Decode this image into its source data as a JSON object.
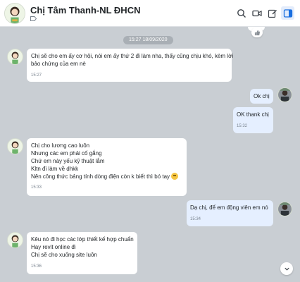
{
  "header": {
    "contact_name": "Chị Tâm Thanh-NL ĐHCN",
    "icons": [
      "search-icon",
      "video-call-icon",
      "edit-icon",
      "sidebar-toggle-icon"
    ]
  },
  "date_divider": "15:27 18/09/2020",
  "messages": [
    {
      "direction": "in",
      "lines": [
        "Chị sẽ cho em ấy cơ hội, nói em ấy thứ 2 đi làm nha, thấy cũng chịu khó, kèm lời",
        "bảo chứng của em nè"
      ],
      "time": "15:27"
    },
    {
      "direction": "out",
      "lines": [
        "Ok chị"
      ]
    },
    {
      "direction": "out",
      "lines": [
        "OK thank chị"
      ],
      "time": "15:32"
    },
    {
      "direction": "in",
      "lines": [
        "Chị cho lương cao luôn",
        "Nhưng các em phải cố gắng",
        "Chứ em này yếu kỹ thuật lắm",
        "Kltn đi làm về dhkk",
        "Nên công thức bảng tính dòng điện còn k biết thì bó tay"
      ],
      "time": "15:33"
    },
    {
      "direction": "out",
      "lines": [
        "Dạ chị, để em động viên em nó"
      ],
      "time": "15:34"
    },
    {
      "direction": "in",
      "lines": [
        "Kêu nó đi học các lớp thiết kế hợp chuẩn",
        "Hay revit online đi",
        "Chị sẽ cho xuống site luôn"
      ],
      "time": "15:36"
    }
  ]
}
